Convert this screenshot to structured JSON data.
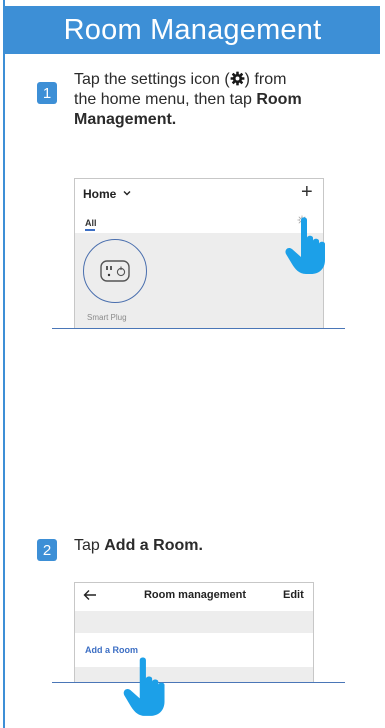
{
  "banner": {
    "title": "Room Management"
  },
  "steps": [
    {
      "number": "1",
      "text_line1_pre": "Tap the settings icon (",
      "text_line1_post": ") from",
      "text_line2_pre": "the home menu, then tap ",
      "text_line2_bold": "Room",
      "text_line3_bold": "Management."
    },
    {
      "number": "2",
      "text_pre": "Tap ",
      "text_bold": "Add a Room."
    }
  ],
  "screenshot1": {
    "home_label": "Home",
    "plus_label": "+",
    "tab_label": "All",
    "device_label": "Smart Plug"
  },
  "screenshot2": {
    "back_label": "←",
    "title": "Room management",
    "edit_label": "Edit",
    "add_room_label": "Add a Room"
  },
  "colors": {
    "accent": "#3d8fd6",
    "link": "#3d6fc4",
    "hand": "#1ca0e8"
  }
}
